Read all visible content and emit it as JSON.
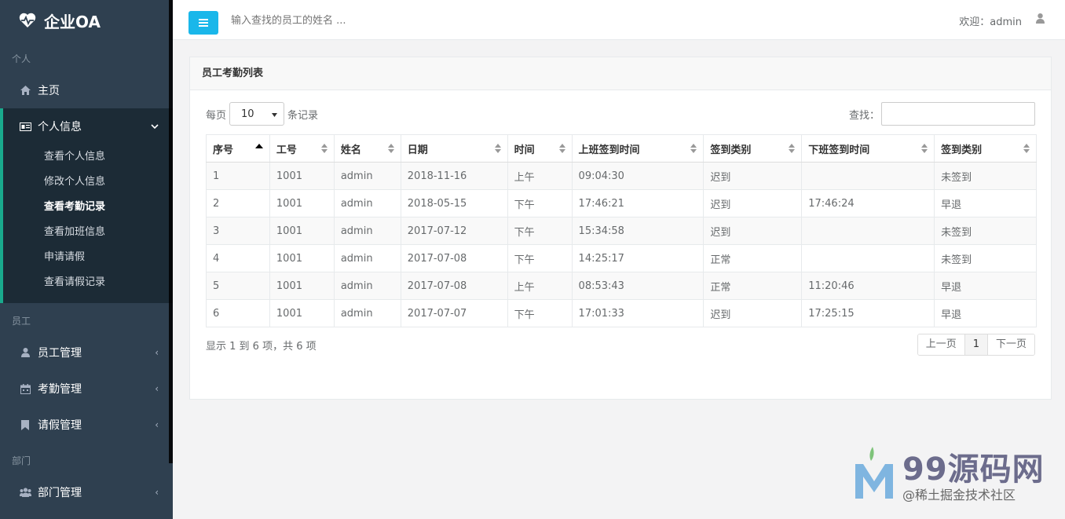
{
  "brand": {
    "title": "企业OA"
  },
  "sidebar": {
    "sections": {
      "personal": "个人",
      "staff": "员工",
      "department": "部门"
    },
    "home": "主页",
    "personal_info": "个人信息",
    "submenu": [
      "查看个人信息",
      "修改个人信息",
      "查看考勤记录",
      "查看加班信息",
      "申请请假",
      "查看请假记录"
    ],
    "staff_manage": "员工管理",
    "attendance_manage": "考勤管理",
    "leave_manage": "请假管理",
    "dept_manage": "部门管理"
  },
  "header": {
    "search_placeholder": "输入查找的员工的姓名 ...",
    "welcome": "欢迎：admin",
    "accent": "#1ab7ea"
  },
  "panel": {
    "title": "员工考勤列表",
    "per_page_prefix": "每页",
    "per_page_value": "10",
    "per_page_suffix": "条记录",
    "search_label": "查找：",
    "info": "显示 1 到 6 项，共 6 项",
    "prev": "上一页",
    "page": "1",
    "next": "下一页"
  },
  "table": {
    "headers": [
      "序号",
      "工号",
      "姓名",
      "日期",
      "时间",
      "上班签到时间",
      "签到类别",
      "下班签到时间",
      "签到类别"
    ],
    "rows": [
      [
        "1",
        "1001",
        "admin",
        "2018-11-16",
        "上午",
        "09:04:30",
        "迟到",
        "",
        "未签到"
      ],
      [
        "2",
        "1001",
        "admin",
        "2018-05-15",
        "下午",
        "17:46:21",
        "迟到",
        "17:46:24",
        "早退"
      ],
      [
        "3",
        "1001",
        "admin",
        "2017-07-12",
        "下午",
        "15:34:58",
        "迟到",
        "",
        "未签到"
      ],
      [
        "4",
        "1001",
        "admin",
        "2017-07-08",
        "下午",
        "14:25:17",
        "正常",
        "",
        "未签到"
      ],
      [
        "5",
        "1001",
        "admin",
        "2017-07-08",
        "上午",
        "08:53:43",
        "正常",
        "11:20:46",
        "早退"
      ],
      [
        "6",
        "1001",
        "admin",
        "2017-07-07",
        "下午",
        "17:01:33",
        "迟到",
        "17:25:15",
        "早退"
      ]
    ]
  },
  "watermark": {
    "title": "99源码网",
    "subtitle": "@稀土掘金技术社区"
  }
}
